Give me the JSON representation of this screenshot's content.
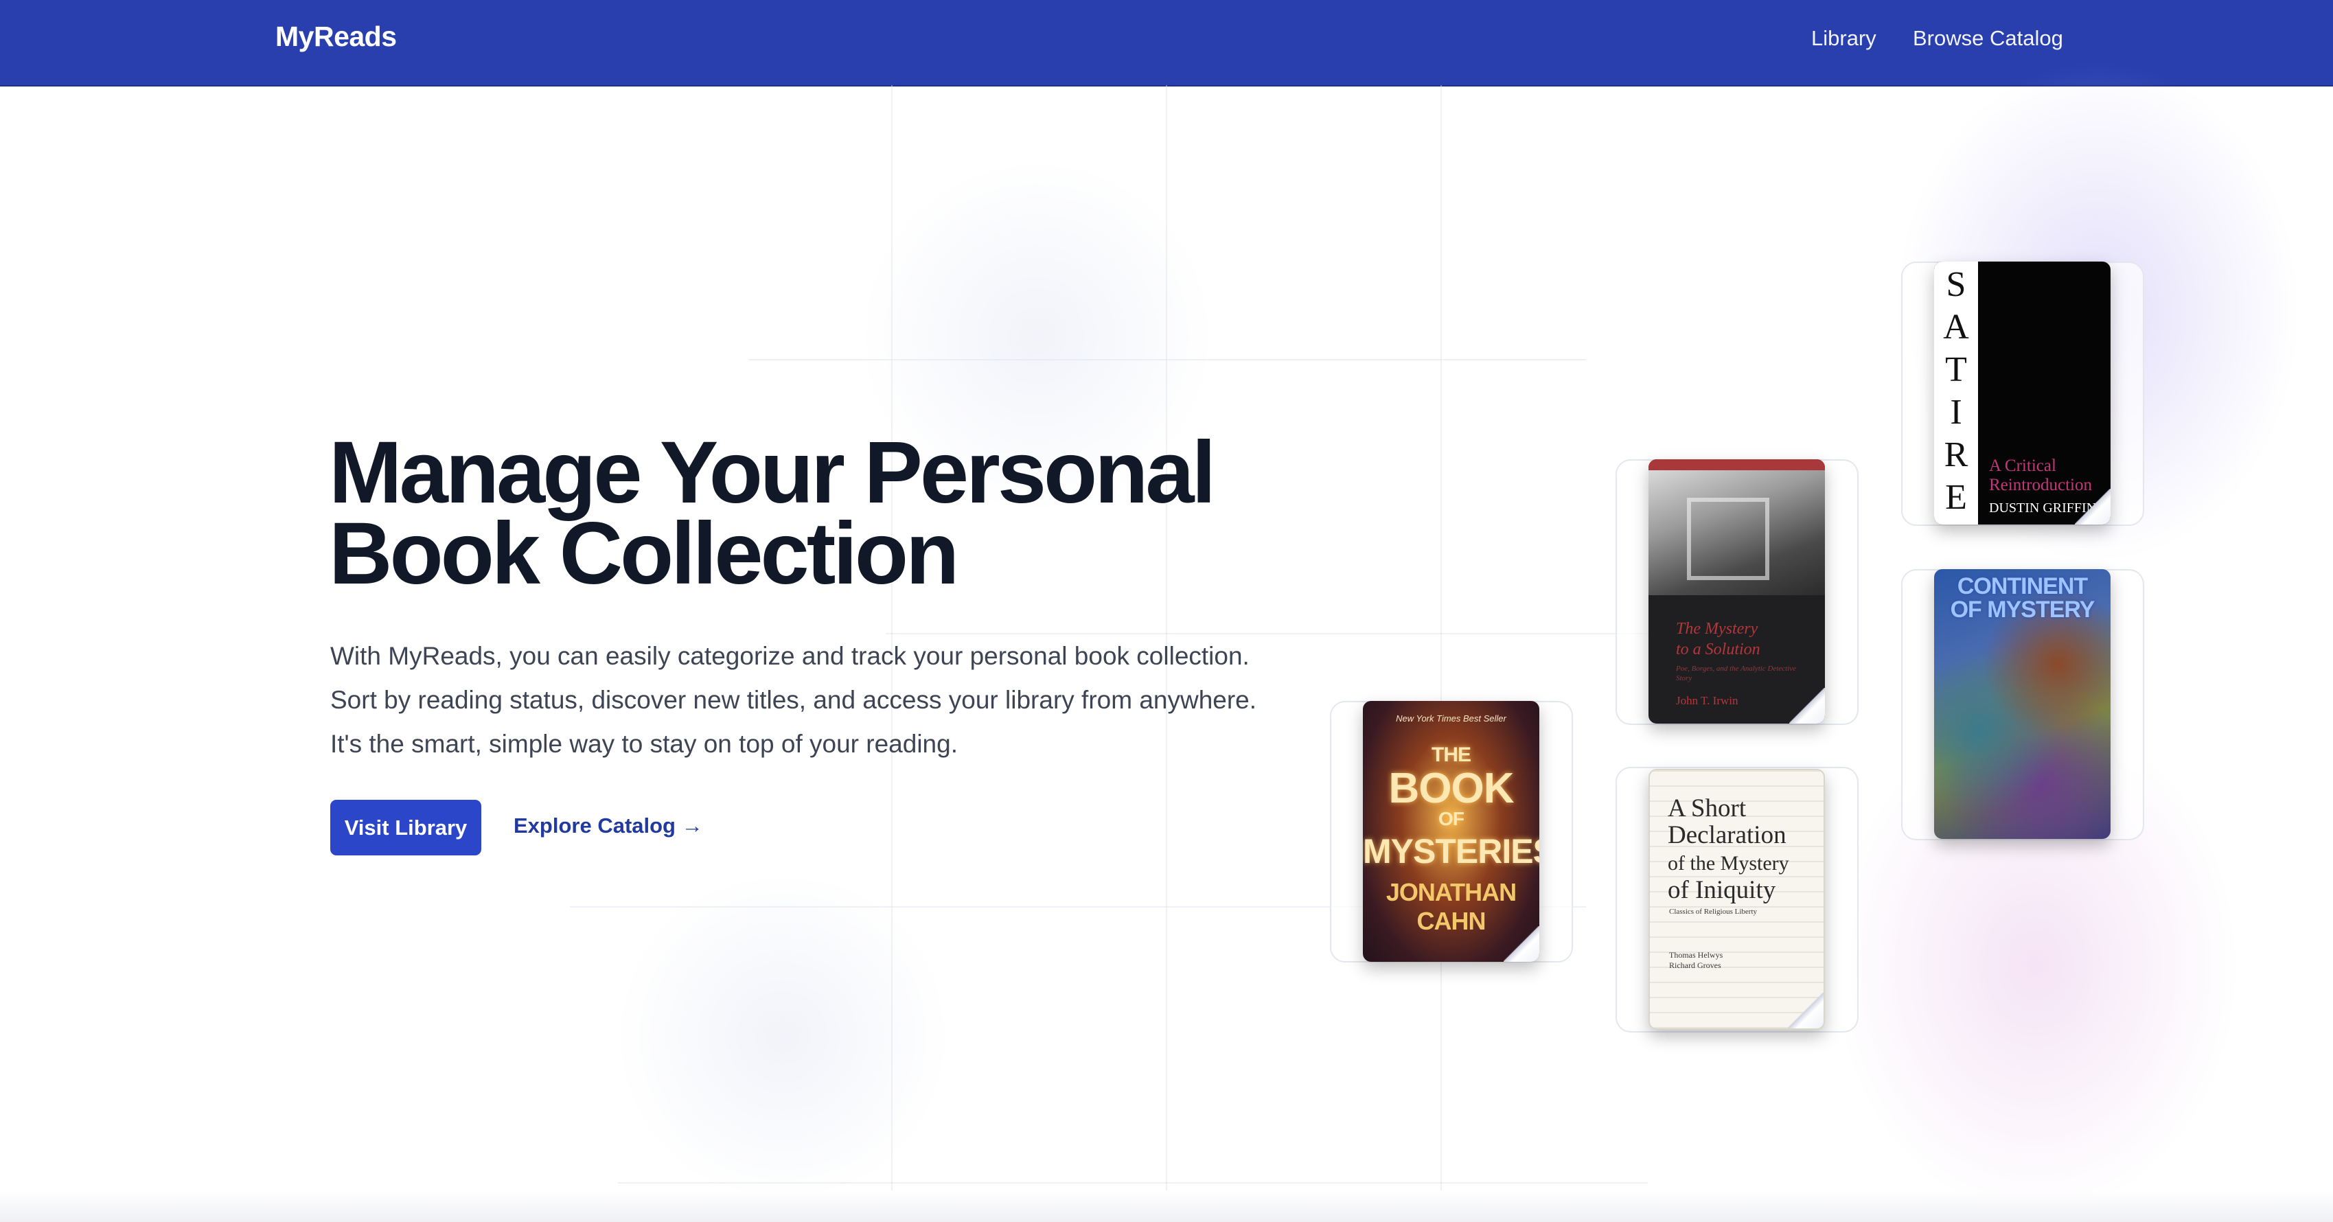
{
  "nav": {
    "brand": "MyReads",
    "links": [
      "Library",
      "Browse Catalog"
    ]
  },
  "hero": {
    "title_line1": "Manage Your Personal",
    "title_line2": "Book Collection",
    "description": [
      "With MyReads, you can easily categorize and track your personal book collection.",
      "Sort by reading status, discover new titles, and access your library from anywhere.",
      "It's the smart, simple way to stay on top of your reading."
    ],
    "primary_button": "Visit Library",
    "secondary_link": "Explore Catalog →"
  },
  "books": {
    "mysteries": {
      "topline": "New York Times Best Seller",
      "title_1": "THE",
      "title_2": "BOOK",
      "title_3": "OF",
      "title_4": "MYSTERIES",
      "author": "JONATHAN CAHN"
    },
    "solution": {
      "title_1": "The Mystery",
      "title_2": "to a Solution",
      "subtitle": "Poe, Borges, and the Analytic Detective Story",
      "author": "John T. Irwin"
    },
    "declaration": {
      "title_1": "A Short",
      "title_2": "Declaration",
      "title_3": "of the Mystery",
      "title_4": "of Iniquity",
      "subtitle": "Classics of Religious Liberty",
      "author_1": "Thomas Helwys",
      "author_2": "Richard Groves"
    },
    "satire": {
      "letters": [
        "S",
        "A",
        "T",
        "I",
        "R",
        "E"
      ],
      "subtitle_1": "A Critical",
      "subtitle_2": "Reintroduction",
      "author": "DUSTIN GRIFFIN"
    },
    "continent": {
      "title_1": "CONTINENT",
      "title_2": "OF MYSTERY"
    }
  },
  "colors": {
    "nav_background": "#283fad",
    "primary_button": "#2b46c8",
    "link": "#223a9e",
    "heading": "#111827",
    "body_text": "#3d4454"
  }
}
